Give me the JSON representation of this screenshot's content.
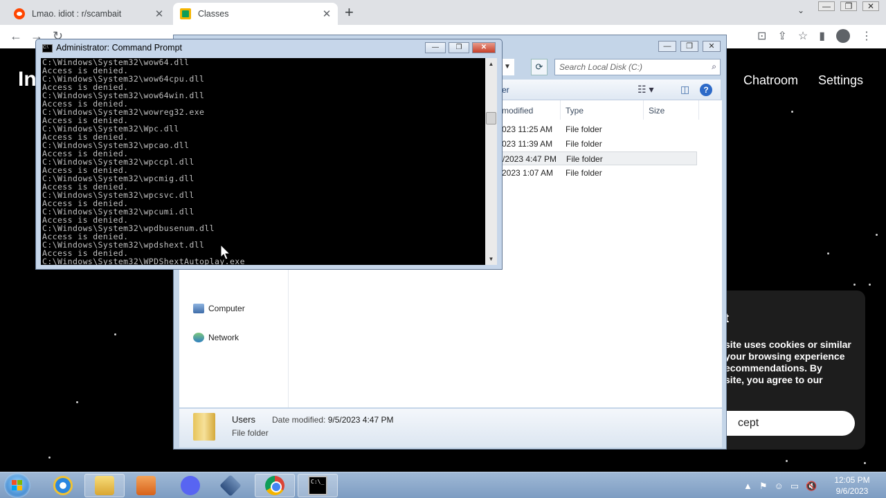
{
  "browser": {
    "tabs": [
      {
        "title": "Lmao. idiot : r/scambait",
        "close": "✕"
      },
      {
        "title": "Classes",
        "close": "✕"
      }
    ],
    "new_tab": "+",
    "tab_search": "⌄",
    "window_controls": {
      "minimize": "—",
      "maximize": "❐",
      "close": "✕"
    },
    "toolbar": {
      "back": "←",
      "forward": "→",
      "reload": "↻"
    }
  },
  "page": {
    "logo": "In",
    "nav": [
      "Chatroom",
      "Settings"
    ],
    "cookie": {
      "title": "t",
      "body": "site uses cookies or similar\nyour browsing experience\necommendations. By\nsite, you agree to our",
      "accept": "cept"
    }
  },
  "explorer": {
    "controls": {
      "minimize": "—",
      "maximize": "❐",
      "close": "✕"
    },
    "address_dropdown": "▼",
    "refresh": "⟳",
    "search_placeholder": "Search Local Disk (C:)",
    "cmdbar_text": "er",
    "columns": [
      "modified",
      "Type",
      "Size"
    ],
    "rows": [
      {
        "date": "023 11:25 AM",
        "type": "File folder"
      },
      {
        "date": "023 11:39 AM",
        "type": "File folder"
      },
      {
        "date": "/2023 4:47 PM",
        "type": "File folder"
      },
      {
        "date": "2023 1:07 AM",
        "type": "File folder"
      }
    ],
    "nav_items": [
      "Computer",
      "Network"
    ],
    "details": {
      "name": "Users",
      "date_label": "Date modified:",
      "date_value": "9/5/2023 4:47 PM",
      "type": "File folder"
    },
    "help": "?"
  },
  "cmd": {
    "title": "Administrator: Command Prompt",
    "icon_text": "C:\\",
    "controls": {
      "minimize": "—",
      "maximize": "❐",
      "close": "✕"
    },
    "lines": [
      "C:\\Windows\\System32\\wow64.dll",
      "Access is denied.",
      "C:\\Windows\\System32\\wow64cpu.dll",
      "Access is denied.",
      "C:\\Windows\\System32\\wow64win.dll",
      "Access is denied.",
      "C:\\Windows\\System32\\wowreg32.exe",
      "Access is denied.",
      "C:\\Windows\\System32\\Wpc.dll",
      "Access is denied.",
      "C:\\Windows\\System32\\wpcao.dll",
      "Access is denied.",
      "C:\\Windows\\System32\\wpccpl.dll",
      "Access is denied.",
      "C:\\Windows\\System32\\wpcmig.dll",
      "Access is denied.",
      "C:\\Windows\\System32\\wpcsvc.dll",
      "Access is denied.",
      "C:\\Windows\\System32\\wpcumi.dll",
      "Access is denied.",
      "C:\\Windows\\System32\\wpdbusenum.dll",
      "Access is denied.",
      "C:\\Windows\\System32\\wpdshext.dll",
      "Access is denied.",
      "C:\\Windows\\System32\\WPDShextAutoplay.exe"
    ]
  },
  "taskbar": {
    "cmd_icon_text": "C:\\_",
    "tray": [
      "▲",
      "⚑",
      "☺",
      "▭",
      "🔇"
    ],
    "time": "12:05 PM",
    "date": "9/6/2023"
  }
}
